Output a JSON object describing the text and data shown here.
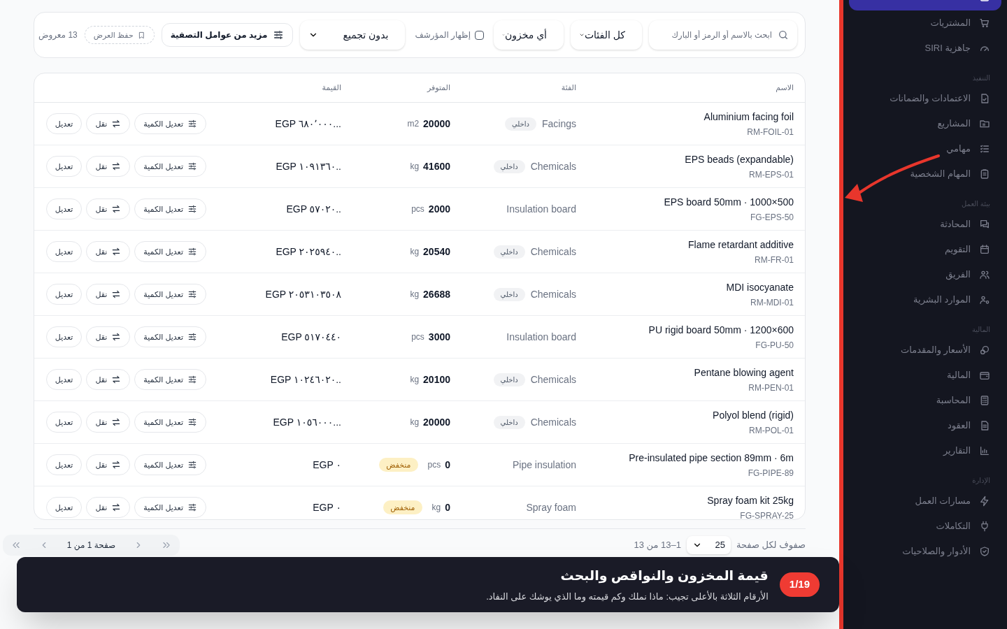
{
  "filters": {
    "search_placeholder": "ابحث بالاسم أو الرمز أو البارك",
    "category_select": "كل الفئات",
    "stock_select": "أي مخزون",
    "archived": {
      "label": "إظهار المؤرشف",
      "checked": false
    },
    "grouping_select": "بدون تجميع",
    "more_filters": "مزيد من عوامل التصفية",
    "save_view": "حفظ العرض",
    "count": "13 معروض"
  },
  "table": {
    "columns": [
      "الاسم",
      "الفئة",
      "المتوفر",
      "القيمة"
    ],
    "rows": [
      {
        "name": "Aluminium facing foil",
        "code": "RM-FOIL-01",
        "category": "Facings",
        "category_tag": "داخلي",
        "quantity": "20000",
        "unit": "m2",
        "value": "EGP ٦٨٠٬٠٠٠...",
        "actions": [
          "تعديل الكمية",
          "نقل",
          "تعديل"
        ]
      },
      {
        "name": "EPS beads (expandable)",
        "code": "RM-EPS-01",
        "category": "Chemicals",
        "category_tag": "داخلي",
        "quantity": "41600",
        "unit": "kg",
        "value": "EGP ١٠٩١٣٦٠..",
        "actions": [
          "تعديل الكمية",
          "نقل",
          "تعديل"
        ]
      },
      {
        "name": "EPS board 50mm · 1000×500",
        "code": "FG-EPS-50",
        "category": "Insulation board",
        "quantity": "2000",
        "unit": "pcs",
        "value": "EGP ٥٧٠٢٠..",
        "actions": [
          "تعديل الكمية",
          "نقل",
          "تعديل"
        ]
      },
      {
        "name": "Flame retardant additive",
        "code": "RM-FR-01",
        "category": "Chemicals",
        "category_tag": "داخلي",
        "quantity": "20540",
        "unit": "kg",
        "value": "EGP ٢٠٢٥٩٤٠..",
        "actions": [
          "تعديل الكمية",
          "نقل",
          "تعديل"
        ]
      },
      {
        "name": "MDI isocyanate",
        "code": "RM-MDI-01",
        "category": "Chemicals",
        "category_tag": "داخلي",
        "quantity": "26688",
        "unit": "kg",
        "value": "EGP ٢٠٥٣١٠٣٥٠٨",
        "actions": [
          "تعديل الكمية",
          "نقل",
          "تعديل"
        ]
      },
      {
        "name": "PU rigid board 50mm · 1200×600",
        "code": "FG-PU-50",
        "category": "Insulation board",
        "quantity": "3000",
        "unit": "pcs",
        "value": "EGP ٥١٧٠٤٤٠",
        "actions": [
          "تعديل الكمية",
          "نقل",
          "تعديل"
        ]
      },
      {
        "name": "Pentane blowing agent",
        "code": "RM-PEN-01",
        "category": "Chemicals",
        "category_tag": "داخلي",
        "quantity": "20100",
        "unit": "kg",
        "value": "EGP ١٠٢٤٦٠٢٠..",
        "actions": [
          "تعديل الكمية",
          "نقل",
          "تعديل"
        ]
      },
      {
        "name": "Polyol blend (rigid)",
        "code": "RM-POL-01",
        "category": "Chemicals",
        "category_tag": "داخلي",
        "quantity": "20000",
        "unit": "kg",
        "value": "EGP ١٠٥٦٠٠٠...",
        "actions": [
          "تعديل الكمية",
          "نقل",
          "تعديل"
        ]
      },
      {
        "name": "Pre-insulated pipe section 89mm · 6m",
        "code": "FG-PIPE-89",
        "category": "Pipe insulation",
        "quantity": "0",
        "unit": "pcs",
        "stock_tag": "منخفض",
        "value": "EGP ٠",
        "actions": [
          "تعديل الكمية",
          "نقل",
          "تعديل"
        ]
      },
      {
        "name": "Spray foam kit 25kg",
        "code": "FG-SPRAY-25",
        "category": "Spray foam",
        "quantity": "0",
        "unit": "kg",
        "stock_tag": "منخفض",
        "value": "EGP ٠",
        "actions": [
          "تعديل الكمية",
          "نقل",
          "تعديل"
        ]
      }
    ]
  },
  "pagination": {
    "rows_per_page": "صفوف لكل صفحة",
    "page_size": "25",
    "range": "1–13 من 13",
    "page": "صفحة 1 من 1"
  },
  "sidebar": [
    {
      "kind": "item",
      "selected": true
    },
    {
      "kind": "item",
      "label": "المشتريات",
      "selected": false
    },
    {
      "kind": "item",
      "label": "جاهزية SIRI",
      "selected": false
    },
    {
      "kind": "section",
      "label": "التنفيذ"
    },
    {
      "kind": "item",
      "label": "الاعتمادات والضمانات",
      "selected": false
    },
    {
      "kind": "item",
      "label": "المشاريع",
      "selected": false
    },
    {
      "kind": "item",
      "label": "مهامي",
      "selected": false
    },
    {
      "kind": "item",
      "label": "المهام الشخصية",
      "selected": false
    },
    {
      "kind": "section",
      "label": "بيئة العمل"
    },
    {
      "kind": "item",
      "label": "المحادثة",
      "selected": false
    },
    {
      "kind": "item",
      "label": "التقويم",
      "selected": false
    },
    {
      "kind": "item",
      "label": "الفريق",
      "selected": false
    },
    {
      "kind": "item",
      "label": "الموارد البشرية",
      "selected": false
    },
    {
      "kind": "section",
      "label": "المالية"
    },
    {
      "kind": "item",
      "label": "الأسعار والمقدمات",
      "selected": false
    },
    {
      "kind": "item",
      "label": "المالية",
      "selected": false
    },
    {
      "kind": "item",
      "label": "المحاسبة",
      "selected": false
    },
    {
      "kind": "item",
      "label": "العقود",
      "selected": false
    },
    {
      "kind": "item",
      "label": "التقارير",
      "selected": false
    },
    {
      "kind": "section",
      "label": "الإدارة"
    },
    {
      "kind": "item",
      "label": "مسارات العمل",
      "selected": false
    },
    {
      "kind": "item",
      "label": "التكاملات",
      "selected": false
    },
    {
      "kind": "item",
      "label": "الأدوار والصلاحيات",
      "selected": false
    }
  ],
  "tour": {
    "step": "1/19",
    "title": "قيمة المخزون والنواقص والبحث",
    "text": "الأرقام الثلاثة بالأعلى تجيب: ماذا نملك وكم قيمته وما الذي يوشك على النفاد."
  }
}
